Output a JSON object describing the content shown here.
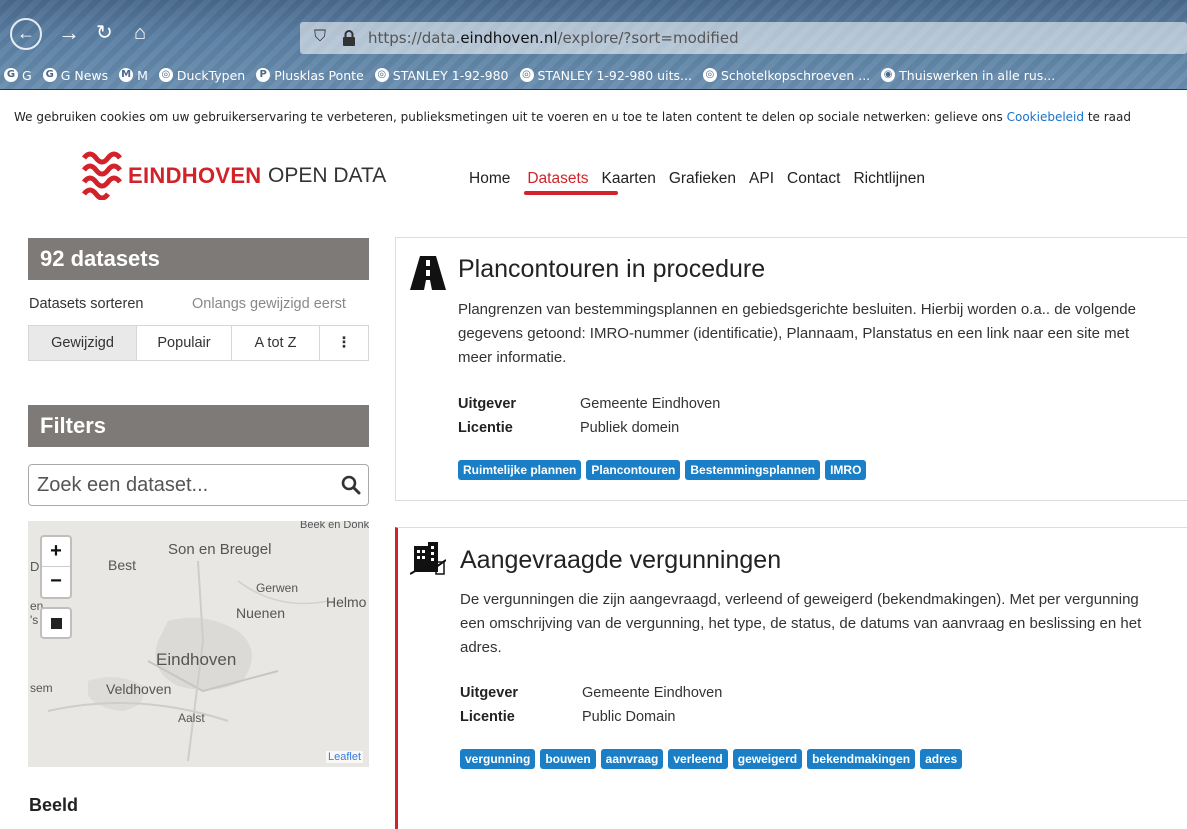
{
  "browser": {
    "url_prefix": "https://data.",
    "url_domain": "eindhoven.nl",
    "url_path": "/explore/?sort=modified",
    "bookmarks": [
      {
        "icon": "G",
        "label": "G"
      },
      {
        "icon": "G",
        "label": "G News"
      },
      {
        "icon": "M",
        "label": "M"
      },
      {
        "icon": "◎",
        "label": "DuckTypen"
      },
      {
        "icon": "P",
        "label": "Plusklas Ponte"
      },
      {
        "icon": "◎",
        "label": "STANLEY 1-92-980"
      },
      {
        "icon": "◎",
        "label": "STANLEY 1-92-980 uits..."
      },
      {
        "icon": "◎",
        "label": "Schotelkopschroeven ..."
      },
      {
        "icon": "◉",
        "label": "Thuiswerken in alle rus..."
      }
    ]
  },
  "cookie": {
    "text": "We gebruiken cookies om uw gebruikerservaring te verbeteren, publieksmetingen uit te voeren en u toe te laten content te delen op sociale netwerken: gelieve ons ",
    "link": "Cookiebeleid",
    "after": " te raad"
  },
  "header": {
    "logo_main": "EINDHOVEN",
    "logo_sub": "OPEN DATA",
    "nav": [
      "Home",
      "Datasets",
      "Kaarten",
      "Grafieken",
      "API",
      "Contact",
      "Richtlijnen"
    ],
    "active_nav": "Datasets"
  },
  "sidebar": {
    "count_title": "92 datasets",
    "sort_label": "Datasets sorteren",
    "sort_value": "Onlangs gewijzigd eerst",
    "sort_tabs": [
      "Gewijzigd",
      "Populair",
      "A tot Z",
      "⋮"
    ],
    "filters_title": "Filters",
    "search_placeholder": "Zoek een dataset...",
    "map": {
      "zoom_in": "+",
      "zoom_out": "−",
      "places": [
        "Beek en Donk",
        "Son en Breugel",
        "Best",
        "Gerwen",
        "Helmo",
        "Nuenen",
        "Eindhoven",
        "Veldhoven",
        "Aalst",
        "sem",
        "Di",
        "en",
        "'s"
      ],
      "attribution": "Leaflet"
    },
    "section_beeld": "Beeld"
  },
  "datasets": [
    {
      "title": "Plancontouren in procedure",
      "description": "Plangrenzen van bestemmingsplannen en gebiedsgerichte besluiten. Hierbij worden o.a.. de volgende gegevens getoond: IMRO-nummer (identificatie), Plannaam, Planstatus en een link naar een site met meer informatie.",
      "publisher_label": "Uitgever",
      "publisher": "Gemeente Eindhoven",
      "license_label": "Licentie",
      "license": "Publiek domein",
      "tags": [
        "Ruimtelijke plannen",
        "Plancontouren",
        "Bestemmingsplannen",
        "IMRO"
      ]
    },
    {
      "title": "Aangevraagde vergunningen",
      "description": "De vergunningen die zijn aangevraagd, verleend of geweigerd (bekendmakingen). Met per vergunning een omschrijving van de vergunning, het type, de status, de datums van aanvraag en beslissing en het adres.",
      "publisher_label": "Uitgever",
      "publisher": "Gemeente Eindhoven",
      "license_label": "Licentie",
      "license": "Public Domain",
      "tags": [
        "vergunning",
        "bouwen",
        "aanvraag",
        "verleend",
        "geweigerd",
        "bekendmakingen",
        "adres"
      ]
    }
  ],
  "colors": {
    "brand_red": "#d2232a",
    "tag_blue": "#1a7fc6",
    "sidebar_header": "#7d7a78"
  }
}
